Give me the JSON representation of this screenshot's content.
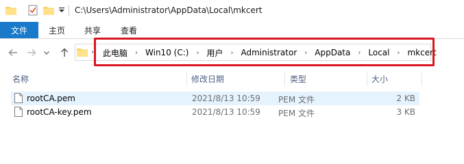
{
  "window": {
    "title": "C:\\Users\\Administrator\\AppData\\Local\\mkcert"
  },
  "ribbon": {
    "tabs": [
      "文件",
      "主页",
      "共享",
      "查看"
    ]
  },
  "address": {
    "breadcrumb": [
      "此电脑",
      "Win10 (C:)",
      "用户",
      "Administrator",
      "AppData",
      "Local",
      "mkcert"
    ],
    "separator": "›"
  },
  "columns": {
    "name": "名称",
    "date": "修改日期",
    "type": "类型",
    "size": "大小"
  },
  "files": [
    {
      "name": "rootCA.pem",
      "modified": "2021/8/13 10:59",
      "type": "PEM 文件",
      "size": "2 KB",
      "selected": true
    },
    {
      "name": "rootCA-key.pem",
      "modified": "2021/8/13 10:59",
      "type": "PEM 文件",
      "size": "3 KB",
      "selected": false
    }
  ],
  "colors": {
    "file_tab": "#1979ca",
    "highlight": "#d8141c",
    "selection": "#e5f3ff"
  }
}
